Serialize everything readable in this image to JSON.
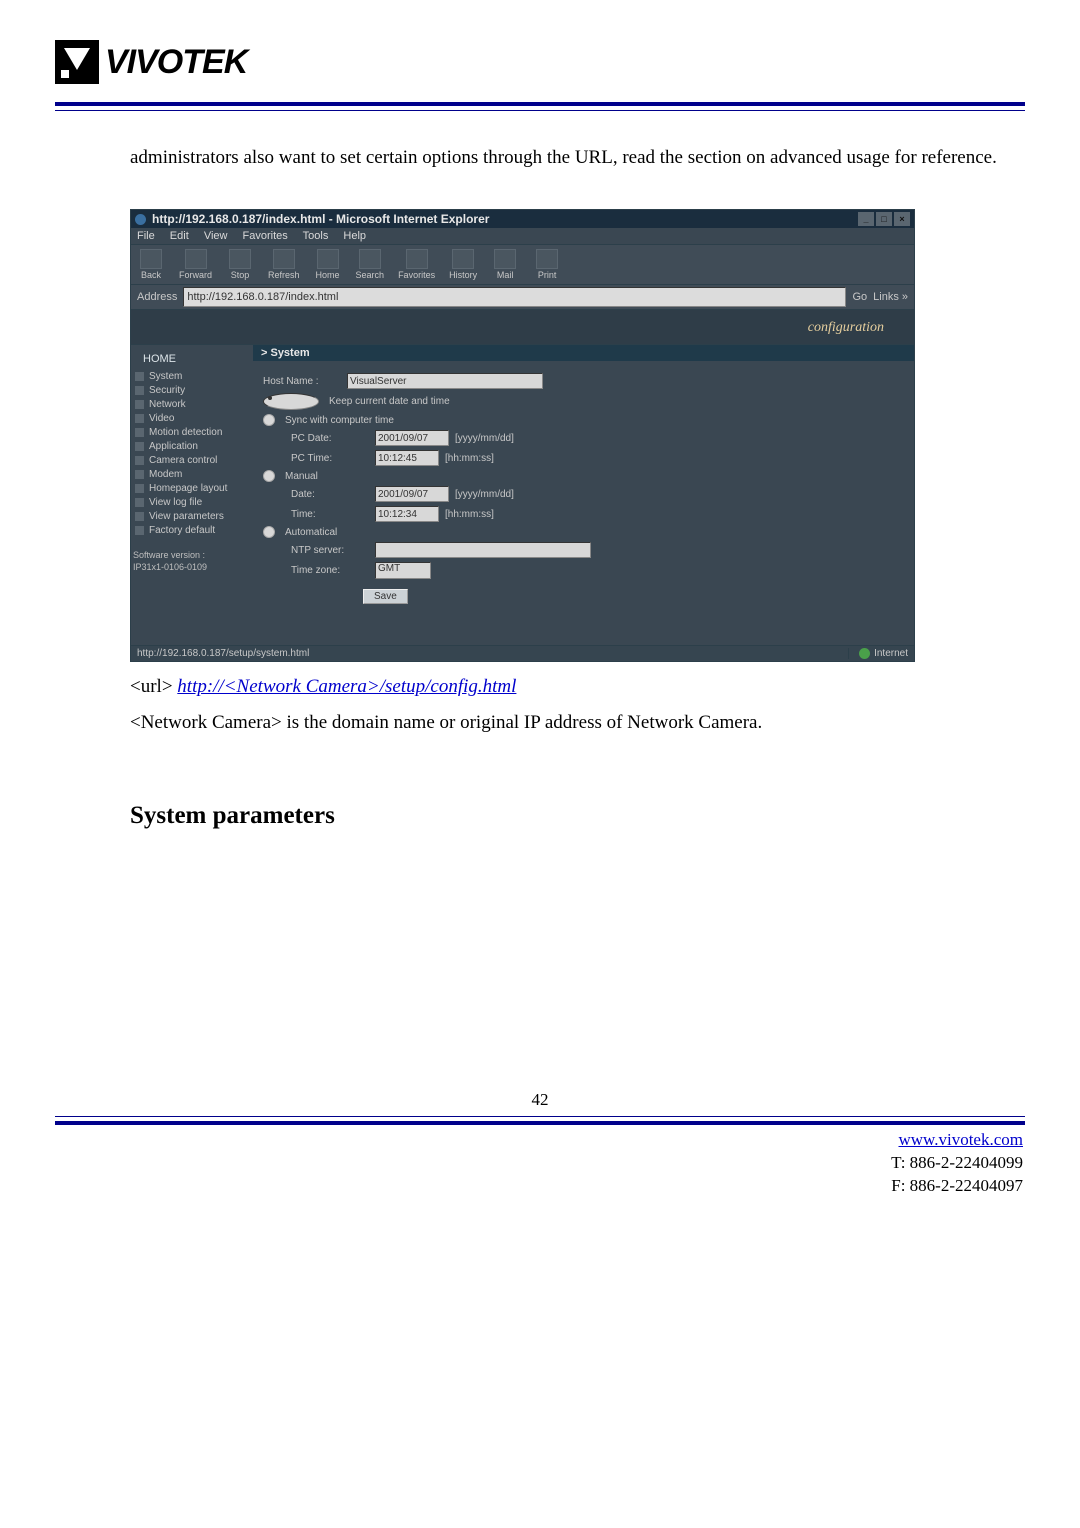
{
  "logo_text": "VIVOTEK",
  "intro_text": "administrators also want to set certain options through the URL, read the section on advanced usage for reference.",
  "ie": {
    "title": "http://192.168.0.187/index.html - Microsoft Internet Explorer",
    "menu": [
      "File",
      "Edit",
      "View",
      "Favorites",
      "Tools",
      "Help"
    ],
    "toolbar": [
      "Back",
      "Forward",
      "Stop",
      "Refresh",
      "Home",
      "Search",
      "Favorites",
      "History",
      "Mail",
      "Print"
    ],
    "address_label": "Address",
    "address_value": "http://192.168.0.187/index.html",
    "go_label": "Go",
    "links_label": "Links »",
    "banner": "configuration",
    "home_label": "HOME",
    "sidebar": [
      "System",
      "Security",
      "Network",
      "Video",
      "Motion detection",
      "Application",
      "Camera control",
      "Modem",
      "Homepage layout",
      "View log file",
      "View parameters",
      "Factory default"
    ],
    "sw_version_label": "Software version :",
    "sw_version_value": "IP31x1-0106-0109",
    "section_title": "> System",
    "host_name_label": "Host Name :",
    "host_name_value": "VisualServer",
    "opt_keep": "Keep current date and time",
    "opt_sync": "Sync with computer time",
    "pc_date_label": "PC Date:",
    "pc_date_value": "2001/09/07",
    "pc_time_label": "PC Time:",
    "pc_time_value": "10:12:45",
    "date_hint": "[yyyy/mm/dd]",
    "time_hint": "[hh:mm:ss]",
    "opt_manual": "Manual",
    "m_date_label": "Date:",
    "m_date_value": "2001/09/07",
    "m_time_label": "Time:",
    "m_time_value": "10:12:34",
    "opt_auto": "Automatical",
    "ntp_label": "NTP server:",
    "ntp_value": "",
    "tz_label": "Time zone:",
    "tz_value": "GMT",
    "save_label": "Save",
    "status_url": "http://192.168.0.187/setup/system.html",
    "status_zone": "Internet"
  },
  "url_prefix": "<url> ",
  "url_link": "http://<Network Camera>/setup/config.html",
  "desc_line": "<Network Camera> is the domain name or original IP address of Network Camera.",
  "section_heading": "System parameters",
  "page_number": "42",
  "footer": {
    "site": "www.vivotek.com",
    "tel": "T: 886-2-22404099",
    "fax": "F: 886-2-22404097"
  }
}
